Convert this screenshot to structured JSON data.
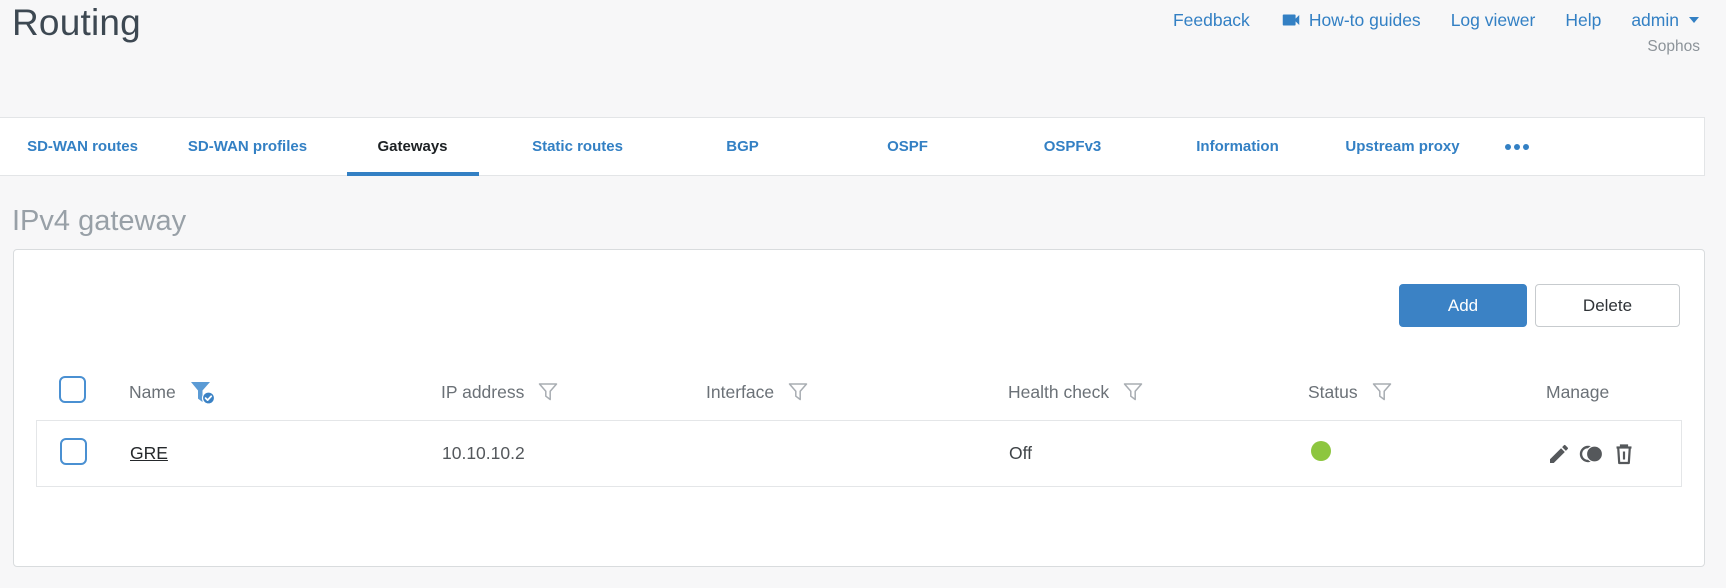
{
  "page": {
    "title": "Routing"
  },
  "header": {
    "links": [
      {
        "label": "Feedback"
      },
      {
        "label": "How-to guides",
        "icon": "video-camera"
      },
      {
        "label": "Log viewer"
      },
      {
        "label": "Help"
      },
      {
        "label": "admin",
        "icon": "caret-down"
      }
    ],
    "brand": "Sophos"
  },
  "tabs": {
    "items": [
      {
        "label": "SD-WAN routes",
        "active": false
      },
      {
        "label": "SD-WAN profiles",
        "active": false
      },
      {
        "label": "Gateways",
        "active": true
      },
      {
        "label": "Static routes",
        "active": false
      },
      {
        "label": "BGP",
        "active": false
      },
      {
        "label": "OSPF",
        "active": false
      },
      {
        "label": "OSPFv3",
        "active": false
      },
      {
        "label": "Information",
        "active": false
      },
      {
        "label": "Upstream proxy",
        "active": false
      }
    ],
    "more": "overflow-menu"
  },
  "section": {
    "title": "IPv4 gateway"
  },
  "toolbar": {
    "add_label": "Add",
    "delete_label": "Delete"
  },
  "table": {
    "columns": [
      {
        "label": "Name",
        "filter": "active"
      },
      {
        "label": "IP address",
        "filter": "inactive"
      },
      {
        "label": "Interface",
        "filter": "inactive"
      },
      {
        "label": "Health check",
        "filter": "inactive"
      },
      {
        "label": "Status",
        "filter": "inactive"
      },
      {
        "label": "Manage",
        "filter": "none"
      }
    ],
    "rows": [
      {
        "name": "GRE",
        "ip_address": "10.10.10.2",
        "interface": "",
        "health_check": "Off",
        "status": "up",
        "manage": [
          "edit",
          "clone",
          "delete"
        ]
      }
    ]
  },
  "colors": {
    "accent_blue": "#3380c4",
    "status_up_green": "#8dc63f",
    "page_background": "#f7f7f8",
    "active_tab_text": "#1d2124",
    "muted_heading": "#98a0a7"
  }
}
